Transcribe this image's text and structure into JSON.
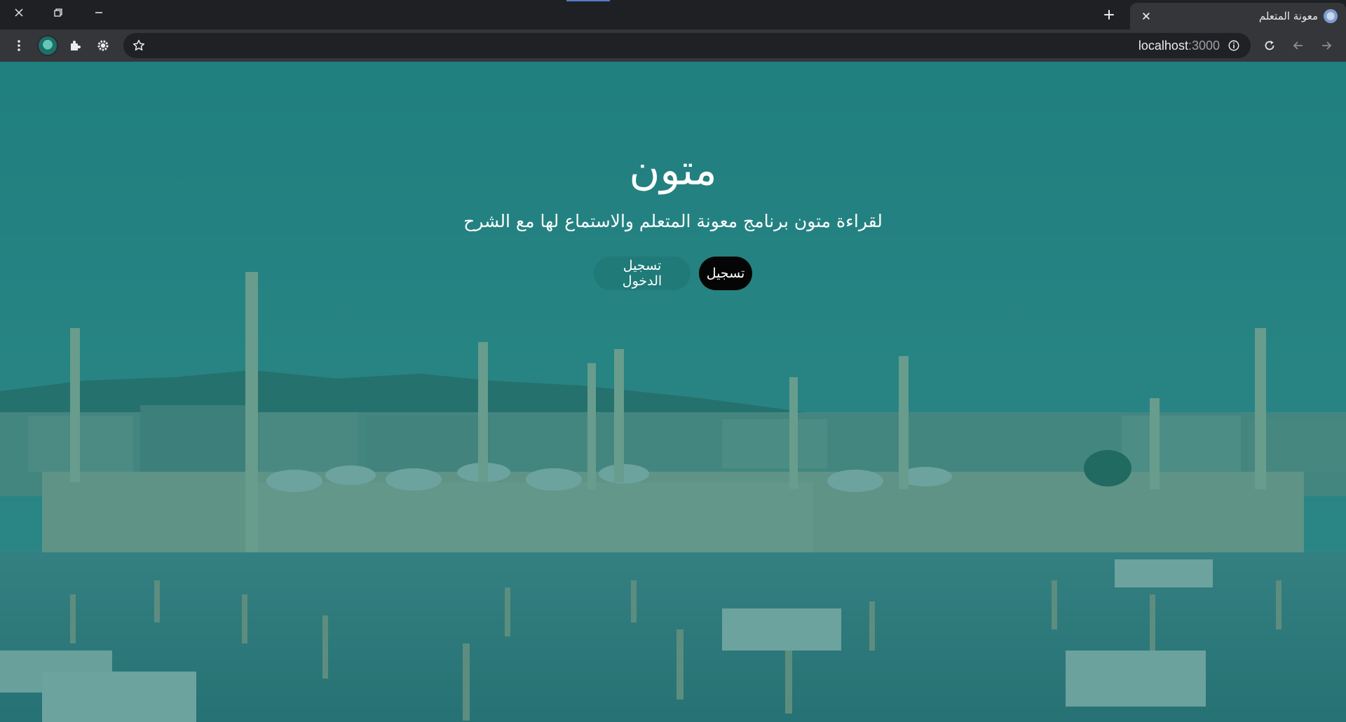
{
  "browser": {
    "tab": {
      "title": "معونة المتعلم",
      "favicon": "globe-favicon-icon"
    },
    "url": {
      "host": "localhost",
      "port": ":3000"
    },
    "icons": {
      "window_close": "close-icon",
      "window_restore": "restore-icon",
      "window_minimize": "minimize-icon",
      "new_tab": "plus-icon",
      "tab_close": "close-icon",
      "menu": "kebab-menu-icon",
      "profile": "avatar",
      "extensions": "puzzle-icon",
      "settings": "gear-icon",
      "bookmark": "star-icon",
      "site_info": "info-icon",
      "reload": "reload-icon",
      "back": "arrow-left-icon",
      "forward": "arrow-right-icon"
    }
  },
  "hero": {
    "title": "متون",
    "subtitle": "لقراءة متون برنامج معونة المتعلم والاستماع لها مع الشرح",
    "buttons": {
      "register": "تسجيل",
      "login": "تسجيل الدخول"
    },
    "overlay_color": "#147676",
    "register_bg": "#050505",
    "login_bg": "#1f7a78"
  }
}
